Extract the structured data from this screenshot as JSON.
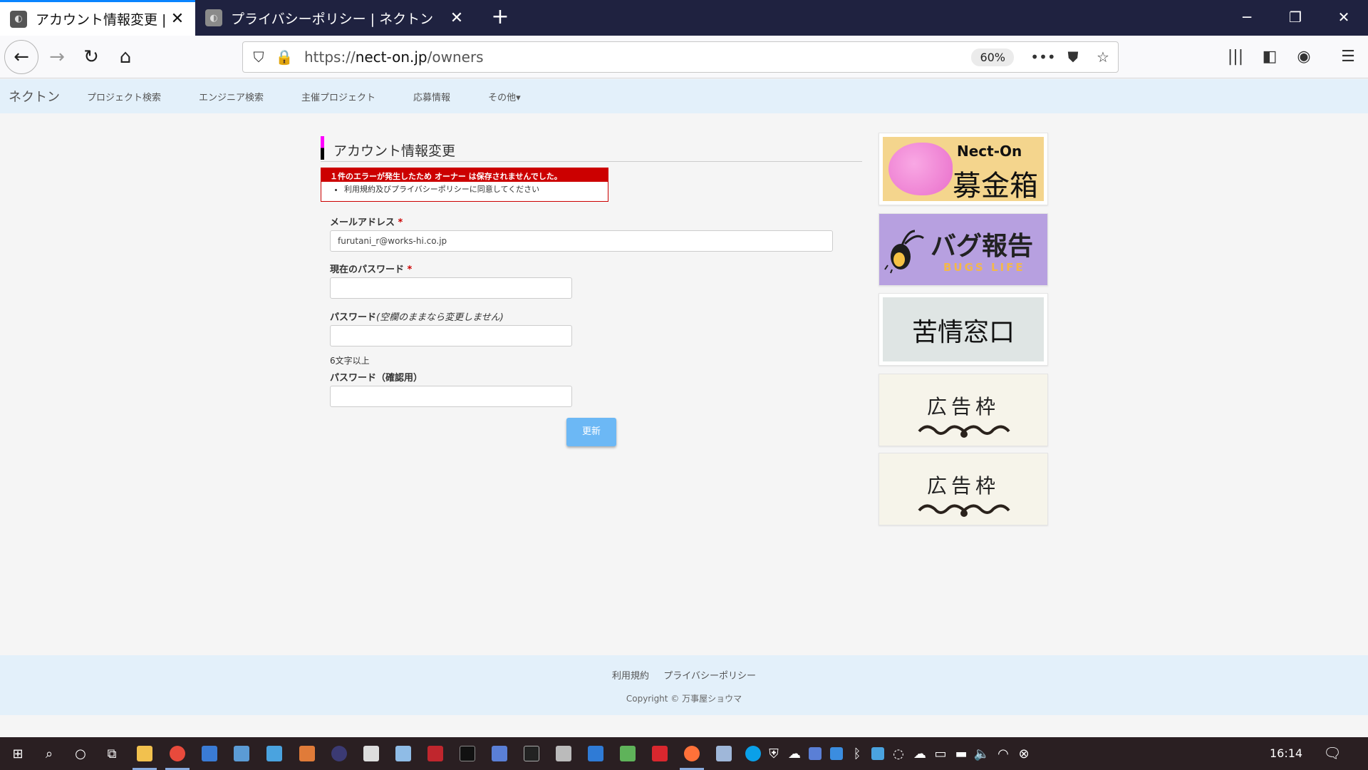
{
  "browser": {
    "tabs": [
      {
        "title": "アカウント情報変更 | ネクトン",
        "active": true
      },
      {
        "title": "プライバシーポリシー | ネクトン",
        "active": false
      }
    ],
    "new_tab_symbol": "+",
    "url_prefix": "https://",
    "url_host": "nect-on.jp",
    "url_path": "/owners",
    "zoom": "60%"
  },
  "site_nav": {
    "brand": "ネクトン",
    "items": [
      "プロジェクト検索",
      "エンジニア検索",
      "主催プロジェクト",
      "応募情報",
      "その他▾"
    ]
  },
  "page": {
    "title": "アカウント情報変更",
    "error_header": "１件のエラーが発生したため オーナー は保存されませんでした。",
    "error_items": [
      "利用規約及びプライバシーポリシーに同意してください"
    ]
  },
  "form": {
    "email_label": "メールアドレス",
    "email_value": "furutani_r@works-hi.co.jp",
    "required_mark": "*",
    "current_password_label": "現在のパスワード",
    "password_label": "パスワード",
    "password_note": "(空欄のままなら変更しません)",
    "password_hint": "6文字以上",
    "password_confirm_label": "パスワード（確認用）",
    "submit_label": "更新"
  },
  "ads": {
    "bank_title": "Nect-On",
    "bank_sub": "募金箱",
    "bug_title": "バグ報告",
    "bug_sub": "BUGS LIFE",
    "claim": "苦情窓口",
    "frame": "広告枠"
  },
  "footer": {
    "links": [
      "利用規約",
      "プライバシーポリシー"
    ],
    "copyright": "Copyright © 万事屋ショウマ"
  },
  "taskbar": {
    "time": "16:14"
  }
}
